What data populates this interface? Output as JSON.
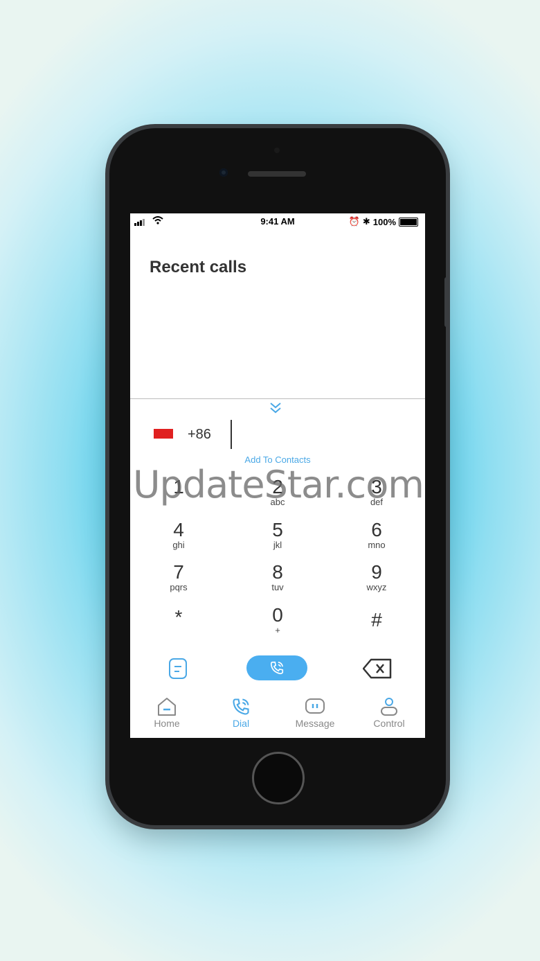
{
  "status_bar": {
    "time": "9:41 AM",
    "battery": "100%"
  },
  "recent_calls": {
    "title": "Recent calls"
  },
  "dialer": {
    "country_code": "+86",
    "add_contacts": "Add To Contacts",
    "keys": [
      {
        "digit": "1",
        "letters": ""
      },
      {
        "digit": "2",
        "letters": "abc"
      },
      {
        "digit": "3",
        "letters": "def"
      },
      {
        "digit": "4",
        "letters": "ghi"
      },
      {
        "digit": "5",
        "letters": "jkl"
      },
      {
        "digit": "6",
        "letters": "mno"
      },
      {
        "digit": "7",
        "letters": "pqrs"
      },
      {
        "digit": "8",
        "letters": "tuv"
      },
      {
        "digit": "9",
        "letters": "wxyz"
      },
      {
        "digit": "*",
        "letters": ""
      },
      {
        "digit": "0",
        "letters": "+"
      },
      {
        "digit": "#",
        "letters": ""
      }
    ]
  },
  "nav": {
    "items": [
      {
        "label": "Home",
        "icon": "home-icon"
      },
      {
        "label": "Dial",
        "icon": "phone-icon",
        "active": true
      },
      {
        "label": "Message",
        "icon": "message-icon"
      },
      {
        "label": "Control",
        "icon": "person-icon"
      }
    ]
  },
  "watermark": "UpdateStar.com",
  "colors": {
    "accent": "#4aa8e6",
    "call_button": "#4aaef0",
    "flag": "#e02020"
  }
}
